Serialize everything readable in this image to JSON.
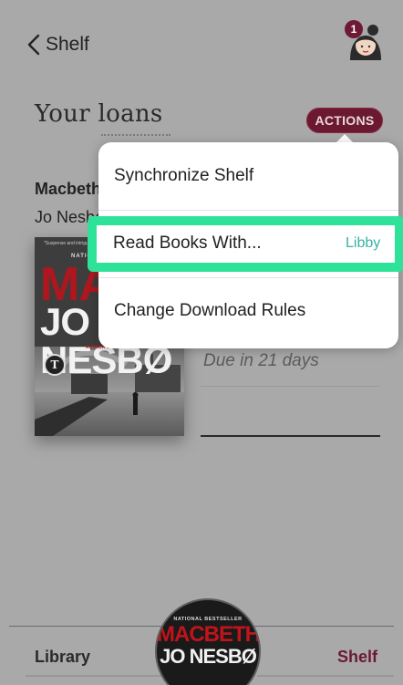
{
  "header": {
    "back_label": "Shelf",
    "notification_count": "1"
  },
  "loans": {
    "title": "Your loans",
    "actions_label": "ACTIONS"
  },
  "book": {
    "title": "Macbeth",
    "author": "Jo Nesbø",
    "due": "Due in 21 days",
    "cover": {
      "tag": "NATIONAL BESTSELLER",
      "title_line1": "MACBETH",
      "title_line2": "JO NESBØ",
      "subtitle": "AUTHOR OF THE SNOWMAN",
      "quote": "\"Suspense and intrigue ...\"",
      "seal_letter": "T"
    }
  },
  "actions_menu": {
    "items": [
      {
        "label": "Synchronize Shelf"
      },
      {
        "label": "Read Books With...",
        "value": "Libby"
      },
      {
        "label": "Change Download Rules"
      }
    ]
  },
  "bottom_nav": {
    "left": "Library",
    "right": "Shelf",
    "mini_cover": {
      "tag": "NATIONAL BESTSELLER",
      "title_line1": "MACBETH",
      "title_line2": "JO NESBØ"
    }
  },
  "colors": {
    "accent": "#6b1931",
    "highlight": "#2fe29a",
    "libby_teal": "#36b3a4"
  }
}
